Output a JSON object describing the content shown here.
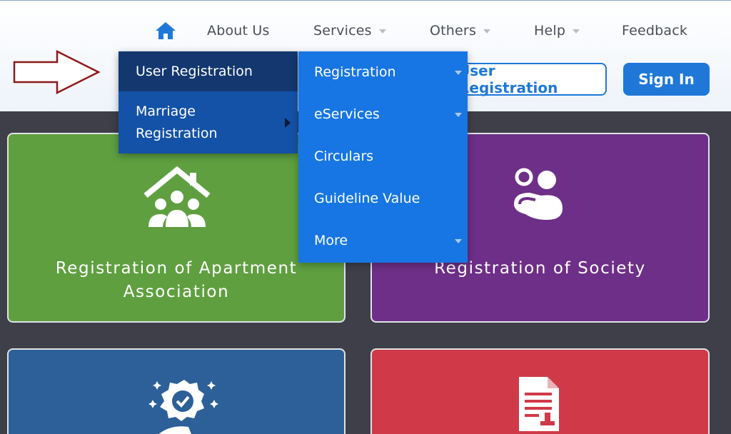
{
  "nav": {
    "home_icon": "home-icon",
    "items": [
      {
        "label": "About Us"
      },
      {
        "label": "Services"
      },
      {
        "label": "Others"
      },
      {
        "label": "Help"
      },
      {
        "label": "Feedback"
      }
    ]
  },
  "header_buttons": {
    "user_registration": "User Registration",
    "sign_in": "Sign In"
  },
  "user_menu": {
    "items": [
      {
        "label": "User Registration"
      },
      {
        "label": "Marriage Registration"
      }
    ]
  },
  "services_menu": {
    "items": [
      {
        "label": "Registration"
      },
      {
        "label": "eServices"
      },
      {
        "label": "Circulars"
      },
      {
        "label": "Guideline Value"
      },
      {
        "label": "More"
      }
    ]
  },
  "cards": [
    {
      "title": "Registration of Apartment Association",
      "color": "#5f9f40",
      "icon": "house-people-icon"
    },
    {
      "title": "Registration of Society",
      "color": "#6d2f87",
      "icon": "users-group-icon"
    },
    {
      "title": "",
      "color": "#2d5f99",
      "icon": "award-hand-icon"
    },
    {
      "title": "",
      "color": "#d03a48",
      "icon": "document-stamp-icon"
    }
  ],
  "colors": {
    "primary": "#1f78d8",
    "menu_dark": "#1452a8",
    "menu_bright": "#1776e3",
    "arrow": "#8b1a1a"
  }
}
